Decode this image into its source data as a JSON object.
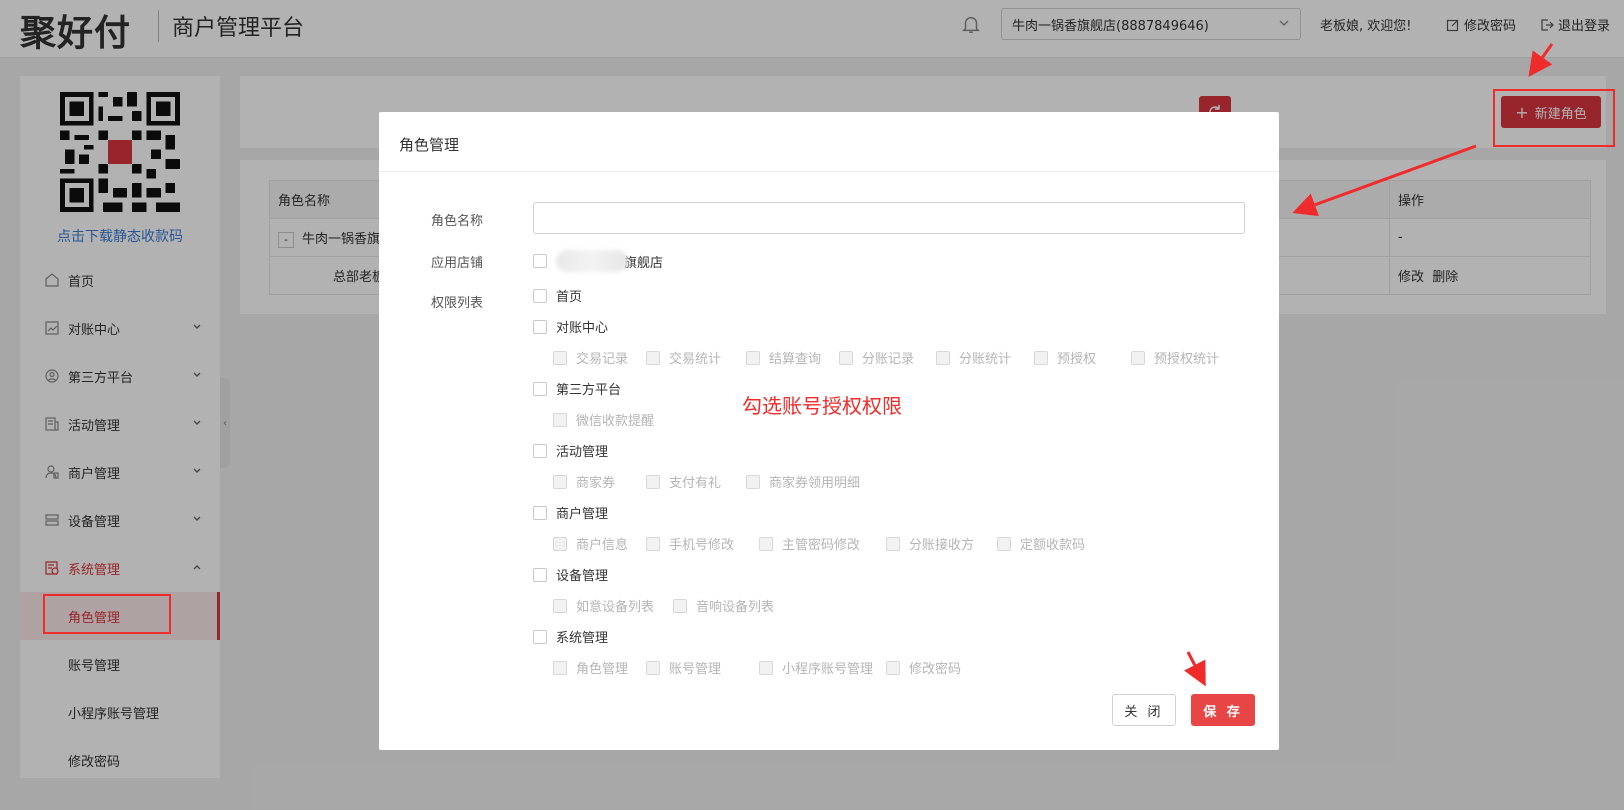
{
  "header": {
    "logo_text": "聚好付",
    "platform_title": "商户管理平台",
    "store_select_value": "牛肉一锅香旗舰店(8887849646)",
    "welcome": "老板娘, 欢迎您!",
    "change_password": "修改密码",
    "logout": "退出登录"
  },
  "sidebar": {
    "qr_link": "点击下载静态收款码",
    "items": [
      {
        "label": "首页",
        "icon": "home-icon"
      },
      {
        "label": "对账中心",
        "icon": "chart-icon"
      },
      {
        "label": "第三方平台",
        "icon": "platform-icon"
      },
      {
        "label": "活动管理",
        "icon": "activity-icon"
      },
      {
        "label": "商户管理",
        "icon": "merchant-icon"
      },
      {
        "label": "设备管理",
        "icon": "device-icon"
      },
      {
        "label": "系统管理",
        "icon": "system-icon"
      }
    ],
    "sub_items": [
      "角色管理",
      "账号管理",
      "小程序账号管理",
      "修改密码"
    ]
  },
  "main": {
    "new_role": "新建角色",
    "table": {
      "headers": [
        "角色名称",
        "操作"
      ],
      "row1_name": "牛肉一锅香旗",
      "row1_action": "-",
      "row2_name": "总部老板",
      "row2_edit": "修改",
      "row2_delete": "删除",
      "expand_mark": "-"
    }
  },
  "modal": {
    "title": "角色管理",
    "role_name_label": "角色名称",
    "role_name_value": "",
    "store_label": "应用店铺",
    "store_option": "旗舰店",
    "perm_label": "权限列表",
    "groups": [
      {
        "label": "首页",
        "children": []
      },
      {
        "label": "对账中心",
        "children": [
          "交易记录",
          "交易统计",
          "结算查询",
          "分账记录",
          "分账统计",
          "预授权",
          "预授权统计"
        ]
      },
      {
        "label": "第三方平台",
        "children": [
          "微信收款提醒"
        ]
      },
      {
        "label": "活动管理",
        "children": [
          "商家券",
          "支付有礼",
          "商家券领用明细"
        ]
      },
      {
        "label": "商户管理",
        "children": [
          "商户信息",
          "手机号修改",
          "主管密码修改",
          "分账接收方",
          "定额收款码"
        ]
      },
      {
        "label": "设备管理",
        "children": [
          "如意设备列表",
          "音响设备列表"
        ]
      },
      {
        "label": "系统管理",
        "children": [
          "角色管理",
          "账号管理",
          "小程序账号管理",
          "修改密码"
        ]
      }
    ],
    "annotation": "勾选账号授权权限",
    "close": "关 闭",
    "save": "保 存"
  },
  "colors": {
    "accent": "#d9363e",
    "annotation": "#f02b2b",
    "link": "#3a7bd5"
  }
}
